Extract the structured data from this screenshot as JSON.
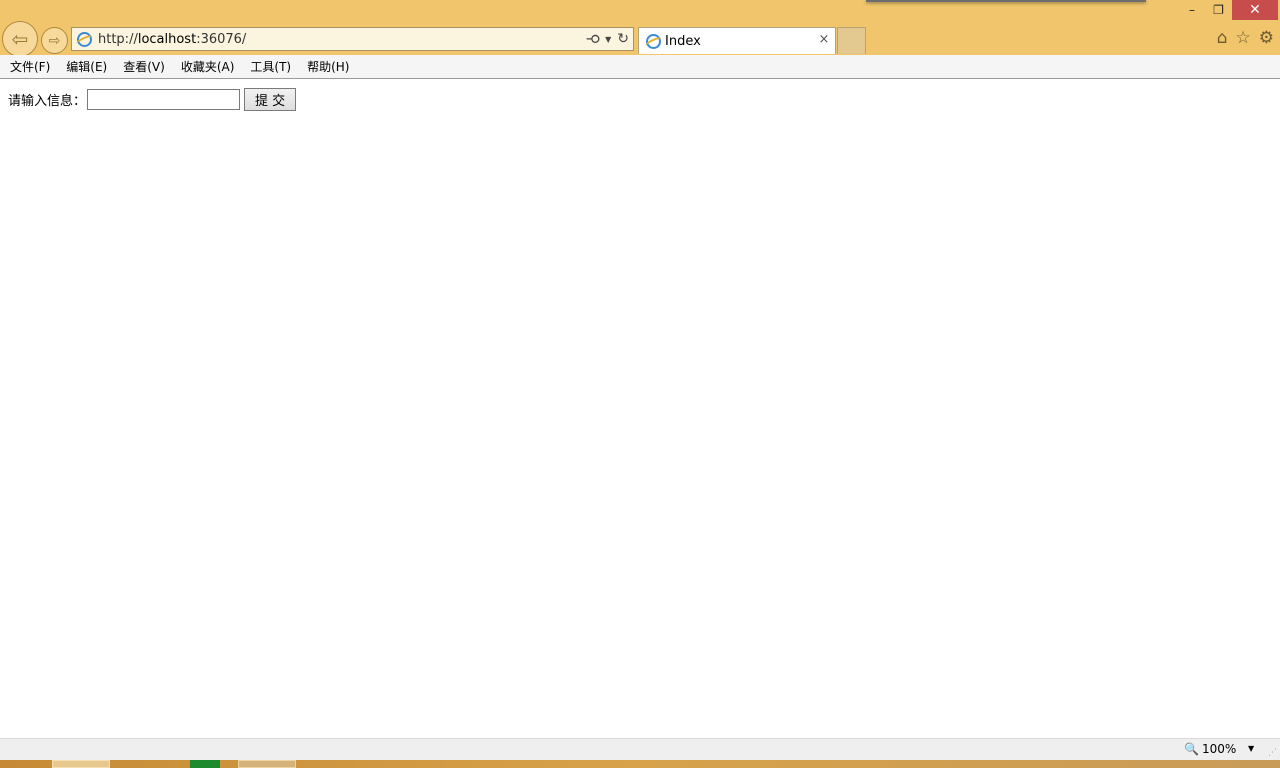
{
  "browser": {
    "url_prefix": "http://",
    "url_host": "localhost",
    "url_suffix": ":36076/",
    "tab_title": "Index",
    "tab_close_glyph": "×",
    "icons": [
      "back-arrow-icon",
      "forward-arrow-icon",
      "ie-logo-icon",
      "search-icon",
      "dropdown-icon",
      "refresh-icon",
      "close-icon",
      "home-icon",
      "star-icon",
      "gear-icon"
    ]
  },
  "window": {
    "minimize_glyph": "–",
    "restore_glyph": "❐",
    "close_glyph": "✕",
    "close_color": "#c74d4d"
  },
  "menubar": {
    "items": [
      "文件(F)",
      "编辑(E)",
      "查看(V)",
      "收藏夹(A)",
      "工具(T)",
      "帮助(H)"
    ]
  },
  "form": {
    "label": "请输入信息：",
    "input_value": "",
    "submit_label": "提 交"
  },
  "statusbar": {
    "zoom": "100%"
  },
  "colors": {
    "chrome": "#f0c56c",
    "menubar": "#f5f5f5",
    "statusbar": "#efefef"
  }
}
